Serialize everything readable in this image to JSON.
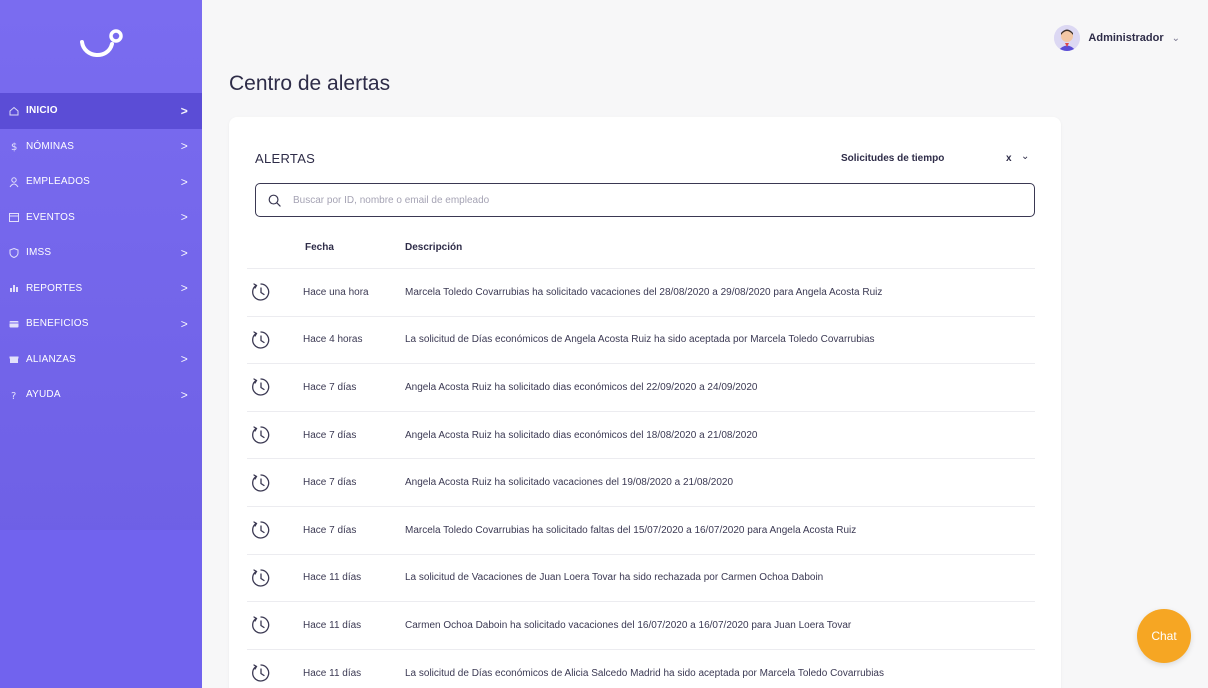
{
  "user": {
    "name": "Administrador"
  },
  "nav": {
    "items": [
      {
        "label": "INICIO",
        "icon": "home-icon",
        "active": true
      },
      {
        "label": "NÓMINAS",
        "icon": "dollar-icon",
        "active": false
      },
      {
        "label": "EMPLEADOS",
        "icon": "users-icon",
        "active": false
      },
      {
        "label": "EVENTOS",
        "icon": "calendar-icon",
        "active": false
      },
      {
        "label": "IMSS",
        "icon": "shield-icon",
        "active": false
      },
      {
        "label": "REPORTES",
        "icon": "chart-icon",
        "active": false
      },
      {
        "label": "BENEFICIOS",
        "icon": "card-icon",
        "active": false
      },
      {
        "label": "ALIANZAS",
        "icon": "gift-icon",
        "active": false
      },
      {
        "label": "AYUDA",
        "icon": "help-icon",
        "active": false
      }
    ],
    "chevron": ">"
  },
  "page": {
    "title": "Centro de alertas"
  },
  "alerts": {
    "heading": "ALERTAS",
    "filter_label": "Solicitudes de tiempo",
    "filter_clear": "x",
    "search_placeholder": "Buscar por ID, nombre o email de empleado",
    "columns": {
      "date": "Fecha",
      "description": "Descripción"
    },
    "rows": [
      {
        "date": "Hace una hora",
        "description": "Marcela Toledo Covarrubias ha solicitado vacaciones del 28/08/2020 a 29/08/2020 para Angela Acosta Ruiz"
      },
      {
        "date": "Hace 4 horas",
        "description": "La solicitud de Días económicos de Angela Acosta Ruiz ha sido aceptada por Marcela Toledo Covarrubias"
      },
      {
        "date": "Hace 7 días",
        "description": "Angela Acosta Ruiz ha solicitado dias económicos del 22/09/2020 a 24/09/2020"
      },
      {
        "date": "Hace 7 días",
        "description": "Angela Acosta Ruiz ha solicitado dias económicos del 18/08/2020 a 21/08/2020"
      },
      {
        "date": "Hace 7 días",
        "description": "Angela Acosta Ruiz ha solicitado vacaciones del 19/08/2020 a 21/08/2020"
      },
      {
        "date": "Hace 7 días",
        "description": "Marcela Toledo Covarrubias ha solicitado faltas del 15/07/2020 a 16/07/2020 para Angela Acosta Ruiz"
      },
      {
        "date": "Hace 11 días",
        "description": "La solicitud de Vacaciones de Juan Loera Tovar ha sido rechazada por Carmen Ochoa Daboin"
      },
      {
        "date": "Hace 11 días",
        "description": "Carmen Ochoa Daboin ha solicitado vacaciones del 16/07/2020 a 16/07/2020 para Juan Loera Tovar"
      },
      {
        "date": "Hace 11 días",
        "description": "La solicitud de Días económicos de Alicia Salcedo Madrid ha sido aceptada por Marcela Toledo Covarrubias"
      }
    ]
  },
  "chat": {
    "label": "Chat"
  },
  "colors": {
    "sidebar": "#7a6cf0",
    "sidebar_active": "#5b4dd6",
    "chat": "#f6a623",
    "text": "#2e2c48"
  }
}
